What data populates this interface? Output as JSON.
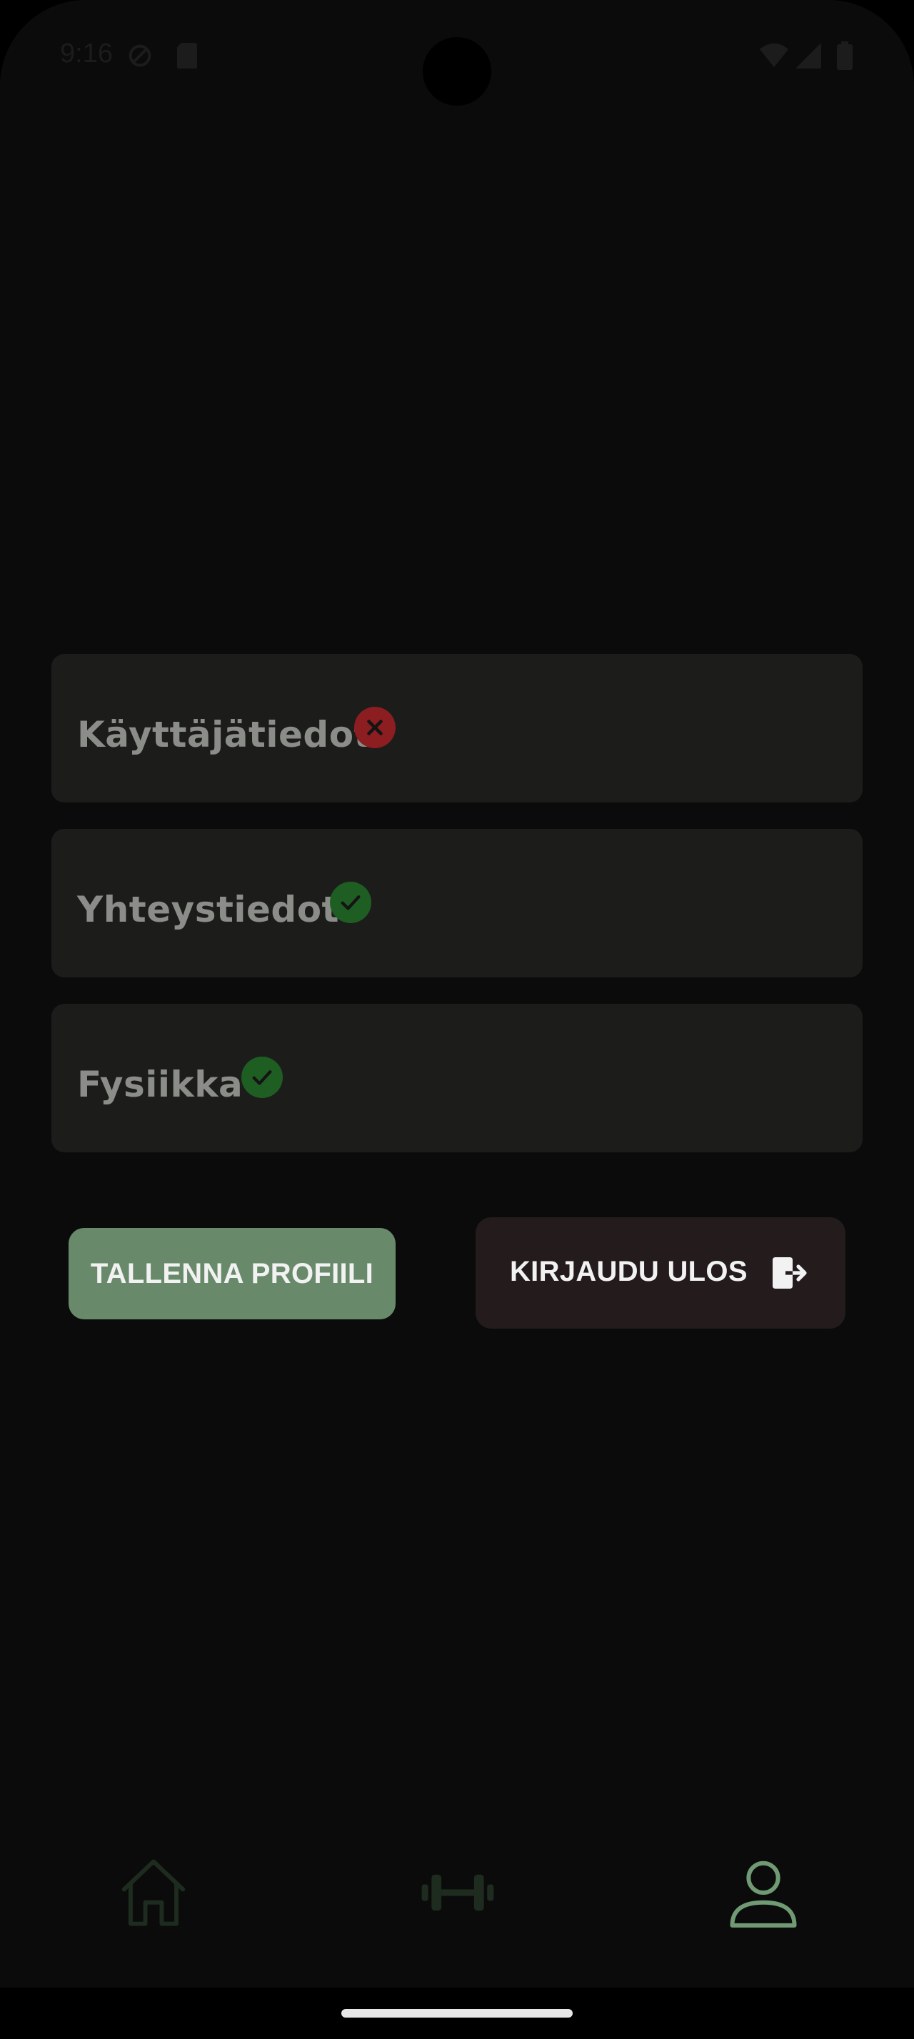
{
  "status_bar": {
    "time": "9:16",
    "icons": [
      "vpn-key-icon",
      "sim-card-icon",
      "wifi-icon",
      "cell-signal-icon",
      "battery-icon"
    ]
  },
  "sections": [
    {
      "label": "Käyttäjätiedot",
      "status": "error",
      "icon": "close-icon"
    },
    {
      "label": "Yhteystiedot",
      "status": "ok",
      "icon": "check-icon"
    },
    {
      "label": "Fysiikka",
      "status": "ok",
      "icon": "check-icon"
    }
  ],
  "actions": {
    "save_label": "TALLENNA PROFIILI",
    "logout_label": "KIRJAUDU ULOS",
    "logout_icon": "logout-icon"
  },
  "bottom_nav": {
    "items": [
      {
        "name": "home",
        "icon": "home-icon",
        "active": false
      },
      {
        "name": "workouts",
        "icon": "dumbbell-icon",
        "active": false
      },
      {
        "name": "profile",
        "icon": "person-icon",
        "active": true
      }
    ]
  },
  "colors": {
    "background": "#0b0b0b",
    "card": "#1c1d1b",
    "label": "#8b8d89",
    "error": "#8c1d20",
    "success": "#1f5e22",
    "save_button": "#688a6b",
    "logout_button": "#241c1c",
    "nav_active": "#6f9a73",
    "nav_inactive": "#1e2b1f"
  }
}
